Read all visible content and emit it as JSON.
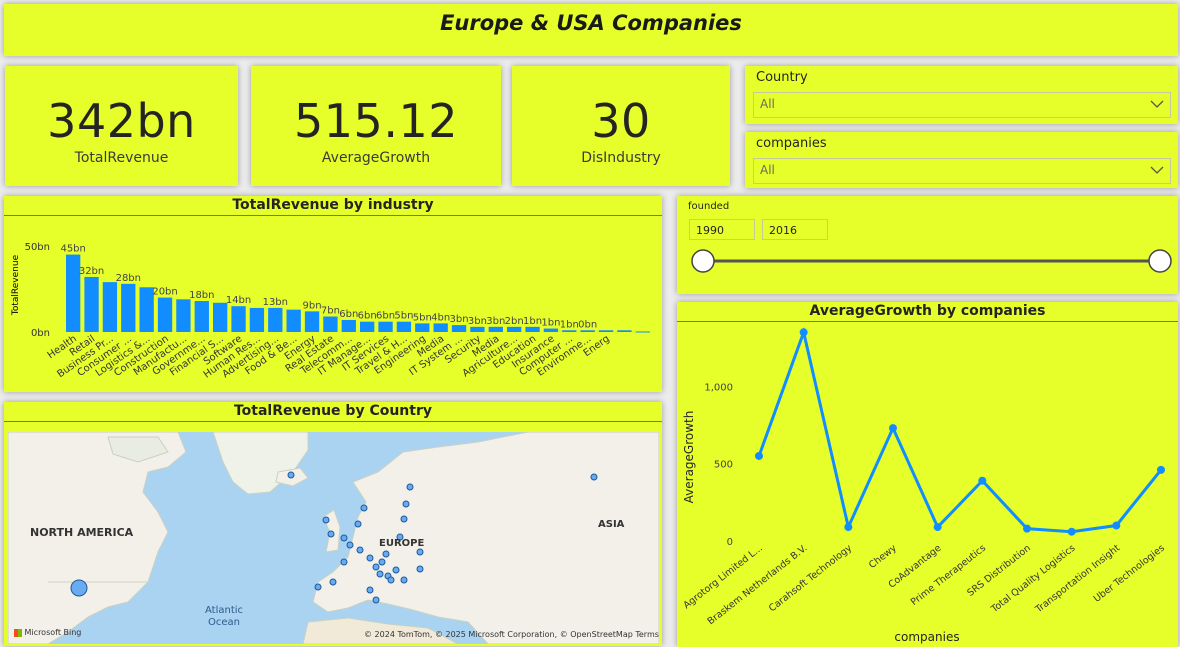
{
  "header": {
    "title": "Europe & USA Companies"
  },
  "kpis": [
    {
      "value": "342bn",
      "label": "TotalRevenue"
    },
    {
      "value": "515.12",
      "label": "AverageGrowth"
    },
    {
      "value": "30",
      "label": "DisIndustry"
    }
  ],
  "slicers": {
    "country": {
      "label": "Country",
      "value": "All",
      "icon": "chevron-down-icon"
    },
    "companies": {
      "label": "companies",
      "value": "All",
      "icon": "chevron-down-icon"
    },
    "founded": {
      "label": "founded",
      "min": "1990",
      "max": "2016",
      "range_fraction": [
        0,
        1
      ]
    }
  },
  "industry_chart": {
    "title": "TotalRevenue by industry",
    "ylabel": "TotalRevenue",
    "accent": "#118dff"
  },
  "map": {
    "title": "TotalRevenue by Country",
    "labels": {
      "north_america": "NORTH AMERICA",
      "europe": "EUROPE",
      "asia": "ASIA",
      "ocean": "Atlantic Ocean",
      "ocean_line1": "Atlantic",
      "ocean_line2": "Ocean"
    },
    "attribution": "© 2024 TomTom, © 2025 Microsoft Corporation, © OpenStreetMap  Terms",
    "brand": "Microsoft Bing"
  },
  "growth_chart": {
    "title": "AverageGrowth by companies",
    "accent": "#118dff"
  },
  "chart_data": [
    {
      "type": "bar",
      "title": "TotalRevenue by industry",
      "xlabel": "",
      "ylabel": "TotalRevenue",
      "ylim": [
        0,
        50
      ],
      "yticks": [
        "0bn",
        "50bn"
      ],
      "categories": [
        "Health",
        "Retail",
        "Business Pr...",
        "Consumer ...",
        "Logistics &...",
        "Construction",
        "Manufactu...",
        "Governme...",
        "Financial S...",
        "Software",
        "Human Res...",
        "Advertising...",
        "Food & Be...",
        "Energy",
        "Real Estate",
        "Telecomm...",
        "IT Manage...",
        "IT Services",
        "Travel & H...",
        "Engineering",
        "Media",
        "IT System ...",
        "Security",
        "Media",
        "Agriculture...",
        "Education",
        "Insurance",
        "Computer ...",
        "Environme...",
        "Energ"
      ],
      "values": [
        45,
        32,
        29,
        28,
        26,
        20,
        19,
        18,
        17,
        15,
        14,
        14,
        13,
        12,
        9,
        7,
        6,
        6,
        6,
        5,
        5,
        4,
        3,
        3,
        3,
        3,
        2,
        1,
        1,
        1,
        1,
        0.3
      ],
      "data_labels": [
        "45bn",
        "32bn",
        "",
        "28bn",
        "",
        "20bn",
        "",
        "18bn",
        "",
        "14bn",
        "",
        "13bn",
        "",
        "9bn",
        "7bn",
        "6bn",
        "6bn",
        "6bn",
        "5bn",
        "5bn",
        "4bn",
        "3bn",
        "3bn",
        "3bn",
        "2bn",
        "1bn",
        "1bn",
        "1bn",
        "0bn"
      ]
    },
    {
      "type": "line",
      "title": "AverageGrowth by companies",
      "xlabel": "companies",
      "ylabel": "AverageGrowth",
      "ylim": [
        0,
        1300
      ],
      "yticks": [
        "0",
        "500",
        "1,000"
      ],
      "ytick_values": [
        0,
        500,
        1000
      ],
      "categories": [
        "Agrotorg Limited L...",
        "Braskem Netherlands B.V.",
        "Carahsoft Technology",
        "Chewy",
        "CoAdvantage",
        "Prime Therapeutics",
        "SRS Distribution",
        "Total Quality Logistics",
        "Transportation Insight",
        "Uber Technologies"
      ],
      "values": [
        550,
        1350,
        90,
        730,
        90,
        390,
        80,
        60,
        100,
        460
      ]
    }
  ]
}
